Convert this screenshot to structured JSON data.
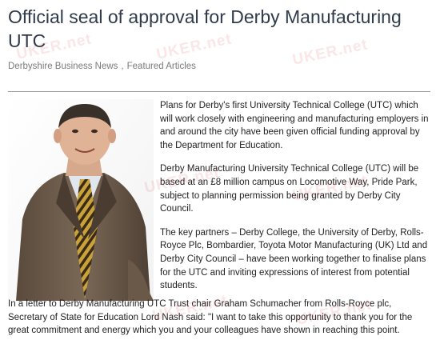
{
  "article": {
    "title": "Official seal of approval for Derby Manufacturing UTC",
    "categories": [
      "Derbyshire Business News",
      "Featured Articles"
    ],
    "separator": ",",
    "paragraphs": [
      "Plans for Derby's first University Technical College (UTC) which will work closely with engineering and manufacturing employers in and around the city have been given official funding approval by the Department for Education.",
      "Derby Manufacturing University Technical College (UTC) will be based at an £8 million campus on Locomotive Way, Pride Park, subject to planning permission being granted by Derby City Council.",
      "The key partners – Derby College, the University of Derby, Rolls-Royce Plc, Bombardier, Toyota Motor Manufacturing (UK) Ltd and Derby City Council – have been working together to finalise plans for the UTC and inviting expressions of interest from potential students.",
      "In a letter to Derby Manufacturing UTC Trust chair Graham Schumacher from Rolls-Royce plc, Secretary of State for Education Lord Nash said: \"I want to take this opportunity to thank you for the great commitment and energy which you and your colleagues have shown in reaching this point."
    ]
  },
  "watermark": "UKER.net",
  "colors": {
    "title": "#2f3a4a",
    "meta": "#7a7a7a",
    "rule": "#9a9a9a",
    "suit": "#6b5a4a",
    "tie": "#c9a23a"
  }
}
